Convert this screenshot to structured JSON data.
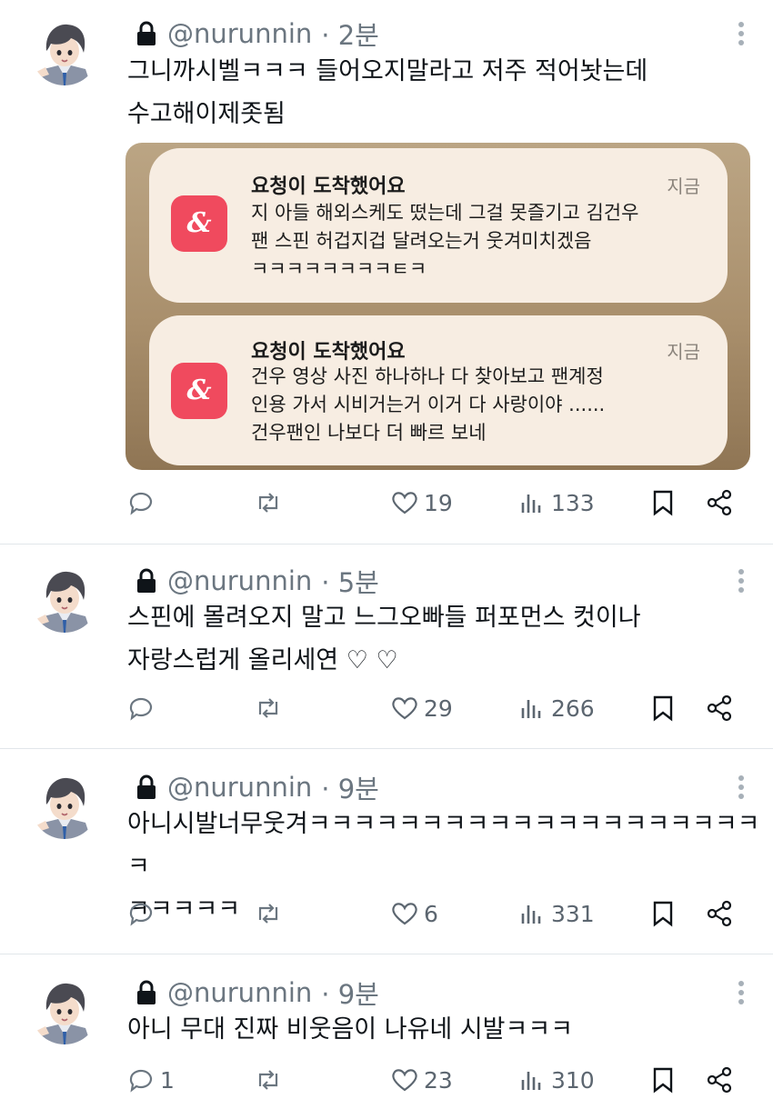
{
  "tweets": [
    {
      "handle": "@nurunnin",
      "time": "· 2분",
      "text": "그니까시벨ㅋㅋㅋ 들어오지말라고 저주 적어놧는데\n수고해이제좃됨",
      "reply_count": "",
      "likes": "19",
      "views": "133"
    },
    {
      "handle": "@nurunnin",
      "time": "· 5분",
      "text": "스핀에 몰려오지 말고 느그오빠들 퍼포먼스 컷이나\n자랑스럽게 올리세연 ♡ ♡",
      "reply_count": "",
      "likes": "29",
      "views": "266"
    },
    {
      "handle": "@nurunnin",
      "time": "· 9분",
      "text": "아니시발너무웃겨ㅋㅋㅋㅋㅋㅋㅋㅋㅋㅋㅋㅋㅋㅋㅋㅋㅋㅋㅋㅋㅋ\nㅋㅋㅋㅋㅋ",
      "reply_count": "",
      "likes": "6",
      "views": "331"
    },
    {
      "handle": "@nurunnin",
      "time": "· 9분",
      "text": "아니 무대 진짜 비웃음이 나유네 시발ㅋㅋㅋ",
      "reply_count": "1",
      "likes": "23",
      "views": "310"
    }
  ],
  "notifications": [
    {
      "title": "요청이 도착했어요",
      "time": "지금",
      "body": "지 아들 해외스케도 떴는데 그걸 못즐기고 김건우\n팬 스핀 허겁지겁 달려오는거 웃겨미치겠음\nㅋㅋㅋㅋㅋㅋㅋㅋㅌㅋ"
    },
    {
      "title": "요청이 도착했어요",
      "time": "지금",
      "body": "건우 영상 사진 하나하나 다 찾아보고 팬계정\n인용 가서 시비거는거 이거 다 사랑이야 ......\n건우팬인 나보다 더 빠르 보네"
    }
  ],
  "icons": {
    "reply": "reply-icon",
    "retweet": "retweet-icon",
    "like": "heart-icon",
    "views": "views-icon",
    "bookmark": "bookmark-icon",
    "share": "share-icon",
    "lock": "lock-icon",
    "more": "more-icon",
    "app": "app-logo-icon"
  },
  "colors": {
    "text": "#0f1419",
    "muted": "#5c6670",
    "divider": "#e1e6ea",
    "app_icon": "#f04a5e"
  }
}
